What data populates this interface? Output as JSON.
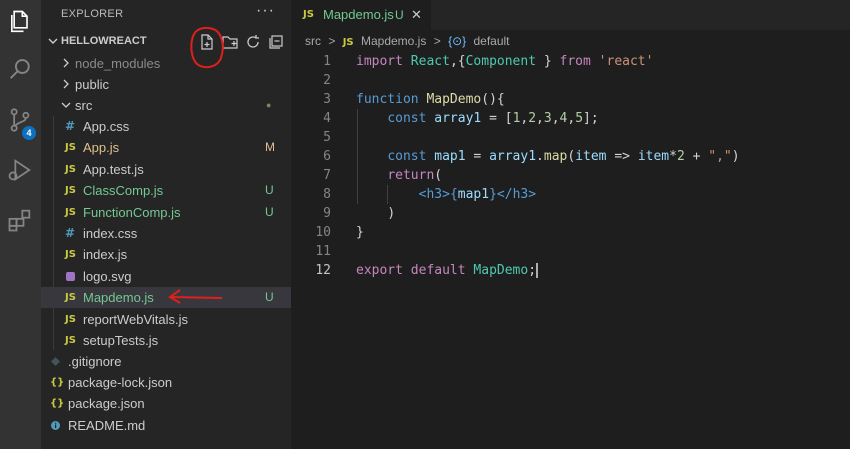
{
  "sidebar": {
    "header": "EXPLORER",
    "more": "···",
    "section_title": "HELLOWREACT",
    "items": [
      {
        "label": "node_modules",
        "icon": "",
        "status": "",
        "color": "dim"
      },
      {
        "label": "public",
        "icon": "",
        "status": "",
        "color": "normal"
      },
      {
        "label": "src",
        "icon": "",
        "status": "●",
        "color": "normal"
      },
      {
        "label": "App.css",
        "icon": "#",
        "status": "",
        "color": "normal"
      },
      {
        "label": "App.js",
        "icon": "JS",
        "status": "M",
        "color": "mod"
      },
      {
        "label": "App.test.js",
        "icon": "JS",
        "status": "",
        "color": "normal"
      },
      {
        "label": "ClassComp.js",
        "icon": "JS",
        "status": "U",
        "color": "untracked"
      },
      {
        "label": "FunctionComp.js",
        "icon": "JS",
        "status": "U",
        "color": "untracked"
      },
      {
        "label": "index.css",
        "icon": "#",
        "status": "",
        "color": "normal"
      },
      {
        "label": "index.js",
        "icon": "JS",
        "status": "",
        "color": "normal"
      },
      {
        "label": "logo.svg",
        "icon": "svg-file-icon",
        "status": "",
        "color": "normal"
      },
      {
        "label": "Mapdemo.js",
        "icon": "JS",
        "status": "U",
        "color": "untracked"
      },
      {
        "label": "reportWebVitals.js",
        "icon": "JS",
        "status": "",
        "color": "normal"
      },
      {
        "label": "setupTests.js",
        "icon": "JS",
        "status": "",
        "color": "normal"
      },
      {
        "label": ".gitignore",
        "icon": "git-diamond-icon",
        "status": "",
        "color": "normal"
      },
      {
        "label": "package-lock.json",
        "icon": "{}",
        "status": "",
        "color": "normal"
      },
      {
        "label": "package.json",
        "icon": "{}",
        "status": "",
        "color": "normal"
      },
      {
        "label": "README.md",
        "icon": "info-icon",
        "status": "",
        "color": "normal"
      }
    ]
  },
  "activity": {
    "scm_badge": "4",
    "icons": [
      "files-icon",
      "search-icon",
      "source-control-icon",
      "run-debug-icon",
      "extensions-icon"
    ]
  },
  "tab": {
    "icon": "JS",
    "label": "Mapdemo.js",
    "status": "U",
    "close": "✕"
  },
  "breadcrumb": {
    "folder": "src",
    "sep": ">",
    "file_icon": "JS",
    "file": "Mapdemo.js",
    "symbol_icon": "{⊙}",
    "symbol": "default"
  },
  "editor": {
    "line_numbers": [
      "1",
      "2",
      "3",
      "4",
      "5",
      "6",
      "7",
      "8",
      "9",
      "10",
      "11",
      "12"
    ],
    "active_line": 12,
    "tokens": {
      "l1": [
        "import",
        " ",
        "React",
        ",{",
        "Component",
        " } ",
        "from",
        " ",
        "'react'"
      ],
      "l3": [
        "function",
        " ",
        "MapDemo",
        "(){"
      ],
      "l4": [
        "const",
        " ",
        "array1",
        " = [",
        "1",
        ",",
        "2",
        ",",
        "3",
        ",",
        "4",
        ",",
        "5",
        "];"
      ],
      "l6": [
        "const",
        " ",
        "map1",
        " = ",
        "array1",
        ".",
        "map",
        "(",
        "item",
        " => ",
        "item",
        "*",
        "2",
        " + ",
        "\",\"",
        ")"
      ],
      "l7": [
        "return",
        "("
      ],
      "l8": [
        "<",
        "h3",
        ">",
        "{",
        "map1",
        "}",
        "</",
        "h3",
        ">"
      ],
      "l9": [
        ")"
      ],
      "l10": [
        "}"
      ],
      "l12": [
        "export",
        " ",
        "default",
        " ",
        "MapDemo",
        ";"
      ]
    }
  },
  "colors": {
    "accent": "#0e70c0",
    "annotation": "#e0201b",
    "untracked": "#73c991",
    "modified": "#e2c08d"
  }
}
